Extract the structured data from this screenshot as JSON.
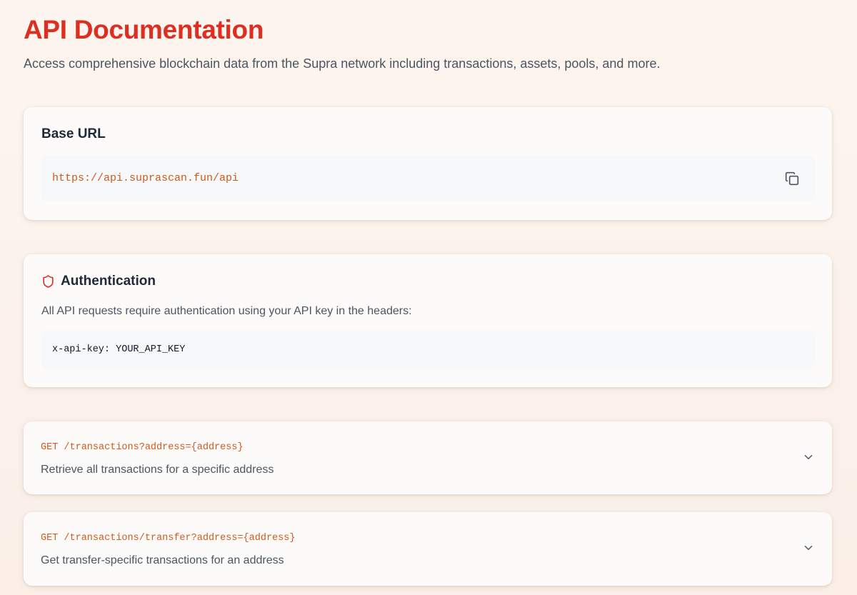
{
  "header": {
    "title": "API Documentation",
    "subtitle": "Access comprehensive blockchain data from the Supra network including transactions, assets, pools, and more."
  },
  "base_url": {
    "heading": "Base URL",
    "url": "https://api.suprascan.fun/api",
    "copy_icon": "copy-icon"
  },
  "authentication": {
    "heading": "Authentication",
    "icon": "shield-icon",
    "description": "All API requests require authentication using your API key in the headers:",
    "header_example": "x-api-key: YOUR_API_KEY"
  },
  "endpoints": [
    {
      "path": "GET /transactions?address={address}",
      "description": "Retrieve all transactions for a specific address",
      "expanded": false
    },
    {
      "path": "GET /transactions/transfer?address={address}",
      "description": "Get transfer-specific transactions for an address",
      "expanded": false
    }
  ],
  "colors": {
    "accent_red": "#dc2f22",
    "code_orange": "#d0591b",
    "background": "#fdf5ef",
    "card": "#fdfbfa"
  }
}
